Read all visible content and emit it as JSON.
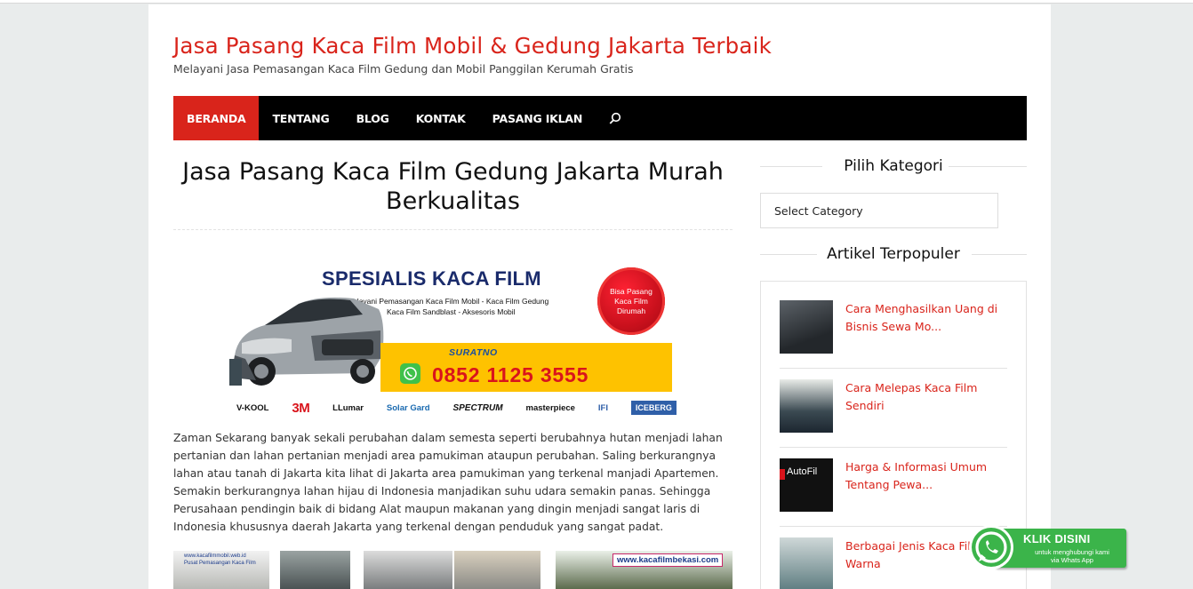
{
  "site": {
    "title": "Jasa Pasang Kaca Film Mobil & Gedung Jakarta Terbaik",
    "description": "Melayani Jasa Pemasangan Kaca Film Gedung dan Mobil Panggilan Kerumah Gratis"
  },
  "nav": {
    "items": [
      "BERANDA",
      "TENTANG",
      "BLOG",
      "KONTAK",
      "PASANG IKLAN"
    ],
    "active_index": 0,
    "search_icon": "search-icon"
  },
  "post": {
    "title": "Jasa Pasang Kaca Film Gedung Jakarta Murah Berkualitas",
    "banner": {
      "heading": "SPESIALIS KACA FILM",
      "sub_line1": "Melayani Pemasangan Kaca Film Mobil - Kaca Film Gedung",
      "sub_line2": "Kaca Film Sandblast - Aksesoris Mobil",
      "badge_line1": "Bisa Pasang",
      "badge_line2": "Kaca Film",
      "badge_line3": "Dirumah",
      "contact_name": "SURATNO",
      "phone": "0852 1125 3555",
      "brands": [
        "V-KOOL",
        "3M",
        "LLumar",
        "Solar Gard",
        "SPECTRUM",
        "masterpiece",
        "IFI",
        "ICEBERG"
      ]
    },
    "paragraph": "Zaman Sekarang banyak sekali perubahan dalam semesta seperti berubahnya hutan menjadi lahan pertanian dan lahan pertanian menjadi area pamukiman ataupun perubahan. Saling berkurangnya lahan atau tanah di Jakarta kita lihat di Jakarta area pamukiman yang terkenal manjadi Apartemen. Semakin berkurangnya lahan hijau di Indonesia manjadikan suhu udara semakin panas. Sehingga Perusahaan pendingin baik di bidang Alat maupun makanan yang dingin menjadi sangat laris di Indonesia khususnya daerah Jakarta yang terkenal dengan penduduk yang sangat padat.",
    "thumb_captions": [
      "www.kacafilmmobil.web.id",
      "Pusat Pemasangan Kaca Film",
      "www.kacafilmbekasi.com"
    ]
  },
  "sidebar": {
    "category_title": "Pilih Kategori",
    "category_select": "Select Category",
    "popular_title": "Artikel Terpopuler",
    "popular": [
      {
        "title": "Cara Menghasilkan Uang di Bisnis Sewa Mo..."
      },
      {
        "title": "Cara Melepas Kaca Film Sendiri"
      },
      {
        "title": "Harga & Informasi Umum Tentang Pewa...",
        "thumb_text": "AutoFil"
      },
      {
        "title": "Berbagai Jenis Kaca Film Warna"
      }
    ]
  },
  "whatsapp": {
    "label": "KLIK DISINI",
    "sub_line1": "untuk menghubungi kami",
    "sub_line2": "via Whats App"
  },
  "colors": {
    "accent": "#d9241b",
    "nav_bg": "#000000",
    "whatsapp_green": "#3bb44a"
  }
}
